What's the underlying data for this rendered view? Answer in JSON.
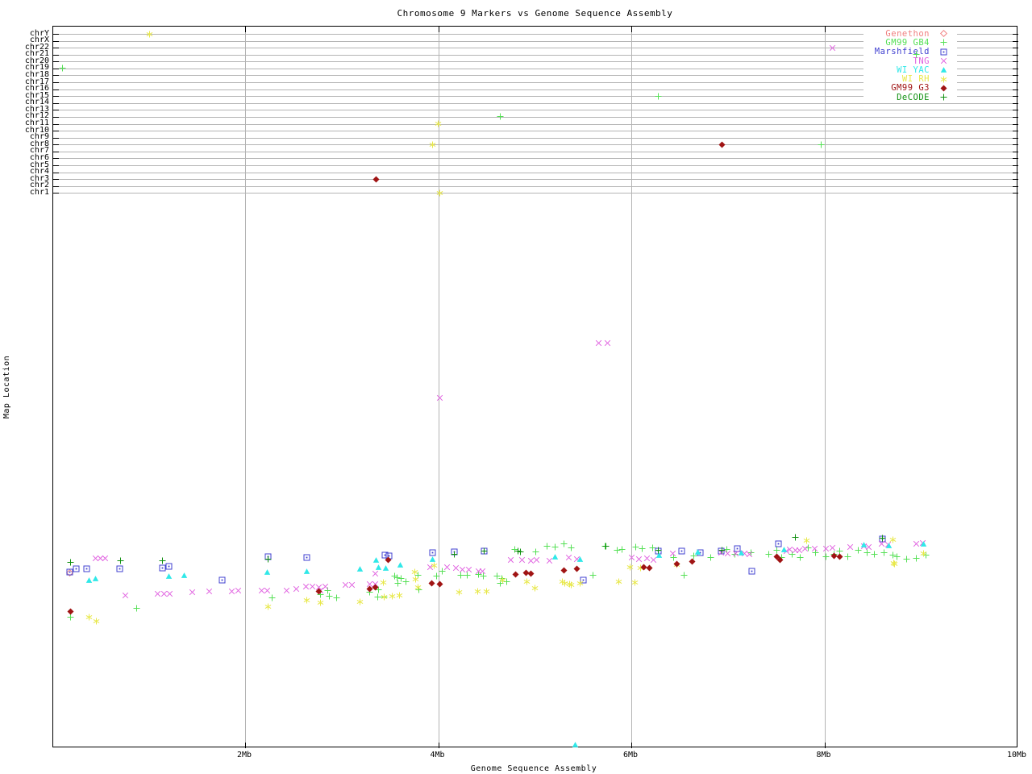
{
  "title": "Chromosome 9 Markers vs Genome Sequence Assembly",
  "axes": {
    "x_label": "Genome Sequence Assembly",
    "y_label": "Map Location",
    "x_ticks": [
      {
        "label": "2Mb",
        "mb": 2
      },
      {
        "label": "4Mb",
        "mb": 4
      },
      {
        "label": "6Mb",
        "mb": 6
      },
      {
        "label": "8Mb",
        "mb": 8
      },
      {
        "label": "10Mb",
        "mb": 10
      }
    ],
    "y_categories": [
      "chrY",
      "chrX",
      "chr22",
      "chr21",
      "chr20",
      "chr19",
      "chr18",
      "chr17",
      "chr16",
      "chr15",
      "chr14",
      "chr13",
      "chr12",
      "chr11",
      "chr10",
      "chr9",
      "chr8",
      "chr7",
      "chr6",
      "chr5",
      "chr4",
      "chr3",
      "chr2",
      "chr1"
    ]
  },
  "style": {
    "gridline_color": "#b4b4b4",
    "frame_color": "#000000",
    "background": "#ffffff"
  },
  "chart_data": {
    "type": "scatter",
    "title": "Chromosome 9 Markers vs Genome Sequence Assembly",
    "xlabel": "Genome Sequence Assembly",
    "ylabel": "Map Location",
    "x_unit": "Mb",
    "xlim": [
      0,
      10
    ],
    "x_gridlines_mb": [
      2,
      4,
      6,
      8
    ],
    "grid": true,
    "legend_position": "top-right",
    "y_axis_categories_top": [
      "chrY",
      "chrX",
      "chr22",
      "chr21",
      "chr20",
      "chr19",
      "chr18",
      "chr17",
      "chr16",
      "chr15",
      "chr14",
      "chr13",
      "chr12",
      "chr11",
      "chr10",
      "chr9",
      "chr8",
      "chr7",
      "chr6",
      "chr5",
      "chr4",
      "chr3",
      "chr2",
      "chr1"
    ],
    "point_format": [
      "x_mb",
      "y_screen_px"
    ],
    "series": [
      {
        "name": "Genethon",
        "color": "#f08080",
        "marker": "diamond-open",
        "chrom_hits": [],
        "band_points": [
          [
            0.18,
            709
          ]
        ]
      },
      {
        "name": "GM99 GB4",
        "color": "#55e055",
        "marker": "plus",
        "chrom_hits": [
          {
            "chrom": "chr19",
            "x_mb": 0.11
          },
          {
            "chrom": "chr21",
            "x_mb": 8.95
          },
          {
            "chrom": "chr15",
            "x_mb": 6.28
          },
          {
            "chrom": "chr12",
            "x_mb": 4.64
          },
          {
            "chrom": "chr8",
            "x_mb": 7.97
          }
        ],
        "band_points": [
          [
            0.19,
            764
          ],
          [
            0.88,
            753
          ],
          [
            2.28,
            740
          ],
          [
            2.78,
            736
          ],
          [
            2.86,
            731
          ],
          [
            2.87,
            738
          ],
          [
            2.95,
            740
          ],
          [
            3.29,
            733
          ],
          [
            3.38,
            730
          ],
          [
            3.37,
            739
          ],
          [
            3.44,
            739
          ],
          [
            3.55,
            713
          ],
          [
            3.57,
            715
          ],
          [
            3.62,
            716
          ],
          [
            3.67,
            720
          ],
          [
            3.58,
            722
          ],
          [
            3.79,
            712
          ],
          [
            3.8,
            730
          ],
          [
            3.98,
            713
          ],
          [
            4.04,
            707
          ],
          [
            4.23,
            712
          ],
          [
            4.3,
            712
          ],
          [
            4.42,
            711
          ],
          [
            4.47,
            713
          ],
          [
            4.61,
            713
          ],
          [
            4.66,
            716
          ],
          [
            4.71,
            720
          ],
          [
            4.64,
            722
          ],
          [
            4.79,
            680
          ],
          [
            5.01,
            683
          ],
          [
            5.13,
            676
          ],
          [
            5.21,
            677
          ],
          [
            5.3,
            673
          ],
          [
            5.38,
            678
          ],
          [
            5.6,
            712
          ],
          [
            5.73,
            676
          ],
          [
            5.85,
            681
          ],
          [
            5.9,
            680
          ],
          [
            6.05,
            677
          ],
          [
            6.11,
            679
          ],
          [
            6.22,
            678
          ],
          [
            6.44,
            690
          ],
          [
            6.55,
            712
          ],
          [
            6.65,
            688
          ],
          [
            6.82,
            690
          ],
          [
            6.99,
            680
          ],
          [
            7.07,
            686
          ],
          [
            7.24,
            684
          ],
          [
            7.42,
            686
          ],
          [
            7.51,
            681
          ],
          [
            7.56,
            690
          ],
          [
            7.67,
            686
          ],
          [
            7.75,
            690
          ],
          [
            7.83,
            678
          ],
          [
            7.91,
            684
          ],
          [
            8.02,
            689
          ],
          [
            8.1,
            686
          ],
          [
            8.16,
            682
          ],
          [
            8.24,
            689
          ],
          [
            8.35,
            681
          ],
          [
            8.44,
            684
          ],
          [
            8.52,
            686
          ],
          [
            8.62,
            684
          ],
          [
            8.71,
            687
          ],
          [
            8.75,
            689
          ],
          [
            8.85,
            692
          ],
          [
            8.95,
            691
          ],
          [
            9.05,
            687
          ]
        ]
      },
      {
        "name": "Marshfield",
        "color": "#4040d0",
        "marker": "box-dot",
        "chrom_hits": [],
        "band_points": [
          [
            0.25,
            704
          ],
          [
            0.36,
            704
          ],
          [
            0.18,
            708
          ],
          [
            0.7,
            704
          ],
          [
            1.14,
            703
          ],
          [
            1.21,
            701
          ],
          [
            1.76,
            718
          ],
          [
            2.24,
            689
          ],
          [
            2.64,
            690
          ],
          [
            3.45,
            687
          ],
          [
            3.49,
            688
          ],
          [
            3.94,
            684
          ],
          [
            4.17,
            683
          ],
          [
            4.48,
            682
          ],
          [
            5.5,
            718
          ],
          [
            6.28,
            682
          ],
          [
            6.52,
            682
          ],
          [
            6.71,
            684
          ],
          [
            6.93,
            682
          ],
          [
            7.1,
            679
          ],
          [
            7.25,
            707
          ],
          [
            7.52,
            673
          ],
          [
            8.6,
            667
          ]
        ]
      },
      {
        "name": "TNG",
        "color": "#e060e0",
        "marker": "cross",
        "chrom_hits": [
          {
            "chrom": "chr22",
            "x_mb": 8.08
          }
        ],
        "band_points": [
          [
            0.45,
            691
          ],
          [
            0.5,
            691
          ],
          [
            0.55,
            691
          ],
          [
            0.76,
            737
          ],
          [
            1.09,
            735
          ],
          [
            1.16,
            735
          ],
          [
            1.22,
            735
          ],
          [
            1.45,
            733
          ],
          [
            1.63,
            732
          ],
          [
            1.86,
            732
          ],
          [
            1.93,
            731
          ],
          [
            2.17,
            731
          ],
          [
            2.23,
            731
          ],
          [
            2.43,
            731
          ],
          [
            2.53,
            729
          ],
          [
            2.63,
            726
          ],
          [
            2.7,
            726
          ],
          [
            2.76,
            727
          ],
          [
            2.78,
            731
          ],
          [
            2.83,
            726
          ],
          [
            3.04,
            724
          ],
          [
            3.11,
            724
          ],
          [
            3.29,
            723
          ],
          [
            3.35,
            723
          ],
          [
            3.35,
            710
          ],
          [
            3.92,
            702
          ],
          [
            4.09,
            702
          ],
          [
            4.18,
            703
          ],
          [
            4.25,
            705
          ],
          [
            4.32,
            705
          ],
          [
            4.42,
            707
          ],
          [
            4.46,
            707
          ],
          [
            4.75,
            693
          ],
          [
            4.87,
            693
          ],
          [
            4.96,
            694
          ],
          [
            5.02,
            693
          ],
          [
            5.15,
            694
          ],
          [
            5.35,
            690
          ],
          [
            5.44,
            692
          ],
          [
            6.0,
            690
          ],
          [
            6.08,
            692
          ],
          [
            6.16,
            691
          ],
          [
            6.23,
            693
          ],
          [
            6.43,
            685
          ],
          [
            6.93,
            684
          ],
          [
            7.0,
            685
          ],
          [
            7.08,
            685
          ],
          [
            7.17,
            685
          ],
          [
            7.22,
            686
          ],
          [
            7.61,
            682
          ],
          [
            7.64,
            680
          ],
          [
            7.7,
            681
          ],
          [
            7.74,
            681
          ],
          [
            7.8,
            679
          ],
          [
            7.9,
            679
          ],
          [
            8.02,
            679
          ],
          [
            8.08,
            678
          ],
          [
            8.27,
            677
          ],
          [
            8.41,
            676
          ],
          [
            8.46,
            677
          ],
          [
            8.59,
            673
          ],
          [
            8.66,
            674
          ],
          [
            8.95,
            673
          ],
          [
            9.02,
            672
          ],
          [
            5.66,
            424
          ],
          [
            5.75,
            424
          ],
          [
            4.02,
            492
          ]
        ]
      },
      {
        "name": "WI YAC",
        "color": "#30e8e8",
        "marker": "triangle-filled",
        "chrom_hits": [],
        "band_points": [
          [
            0.38,
            718
          ],
          [
            0.45,
            716
          ],
          [
            1.21,
            713
          ],
          [
            1.37,
            712
          ],
          [
            2.23,
            708
          ],
          [
            2.64,
            707
          ],
          [
            3.19,
            704
          ],
          [
            3.36,
            693
          ],
          [
            3.38,
            702
          ],
          [
            3.46,
            703
          ],
          [
            3.61,
            699
          ],
          [
            3.94,
            692
          ],
          [
            5.21,
            689
          ],
          [
            5.47,
            692
          ],
          [
            6.29,
            687
          ],
          [
            6.69,
            683
          ],
          [
            7.14,
            684
          ],
          [
            7.58,
            680
          ],
          [
            8.41,
            674
          ],
          [
            8.67,
            675
          ],
          [
            9.03,
            673
          ],
          [
            5.42,
            922
          ]
        ]
      },
      {
        "name": "WI RH",
        "color": "#e8e84a",
        "marker": "asterisk",
        "chrom_hits": [
          {
            "chrom": "chrY",
            "x_mb": 1.01
          },
          {
            "chrom": "chr11",
            "x_mb": 4.0
          },
          {
            "chrom": "chr8",
            "x_mb": 3.94
          },
          {
            "chrom": "chr1",
            "x_mb": 4.02
          }
        ],
        "band_points": [
          [
            0.38,
            764
          ],
          [
            0.46,
            769
          ],
          [
            2.24,
            751
          ],
          [
            2.64,
            743
          ],
          [
            2.78,
            746
          ],
          [
            3.19,
            745
          ],
          [
            3.43,
            721
          ],
          [
            3.52,
            738
          ],
          [
            3.44,
            739
          ],
          [
            3.6,
            737
          ],
          [
            3.76,
            708
          ],
          [
            3.77,
            717
          ],
          [
            3.79,
            727
          ],
          [
            3.96,
            700
          ],
          [
            4.22,
            733
          ],
          [
            4.41,
            732
          ],
          [
            4.5,
            732
          ],
          [
            4.67,
            718
          ],
          [
            4.92,
            720
          ],
          [
            5.0,
            728
          ],
          [
            5.29,
            720
          ],
          [
            5.31,
            722
          ],
          [
            5.36,
            723
          ],
          [
            5.38,
            724
          ],
          [
            5.47,
            722
          ],
          [
            5.87,
            720
          ],
          [
            5.99,
            702
          ],
          [
            6.04,
            721
          ],
          [
            6.1,
            703
          ],
          [
            6.47,
            699
          ],
          [
            7.82,
            669
          ],
          [
            8.71,
            668
          ],
          [
            8.72,
            697
          ],
          [
            8.73,
            698
          ],
          [
            9.03,
            685
          ]
        ]
      },
      {
        "name": "GM99 G3",
        "color": "#a01414",
        "marker": "diamond-filled",
        "chrom_hits": [
          {
            "chrom": "chr8",
            "x_mb": 6.94
          },
          {
            "chrom": "chr3",
            "x_mb": 3.36
          }
        ],
        "band_points": [
          [
            0.19,
            757
          ],
          [
            2.76,
            732
          ],
          [
            3.29,
            729
          ],
          [
            3.35,
            727
          ],
          [
            3.48,
            693
          ],
          [
            3.93,
            722
          ],
          [
            4.02,
            723
          ],
          [
            4.8,
            711
          ],
          [
            4.91,
            709
          ],
          [
            4.96,
            710
          ],
          [
            5.3,
            706
          ],
          [
            5.44,
            704
          ],
          [
            6.13,
            702
          ],
          [
            6.19,
            703
          ],
          [
            6.47,
            698
          ],
          [
            6.63,
            695
          ],
          [
            7.51,
            689
          ],
          [
            7.54,
            693
          ],
          [
            8.1,
            688
          ],
          [
            8.16,
            689
          ]
        ]
      },
      {
        "name": "DeCODE",
        "color": "#109010",
        "marker": "plus",
        "chrom_hits": [],
        "band_points": [
          [
            0.19,
            696
          ],
          [
            0.71,
            694
          ],
          [
            1.14,
            694
          ],
          [
            2.24,
            692
          ],
          [
            4.17,
            686
          ],
          [
            4.48,
            682
          ],
          [
            4.83,
            682
          ],
          [
            4.85,
            683
          ],
          [
            5.74,
            676
          ],
          [
            6.28,
            681
          ],
          [
            6.94,
            681
          ],
          [
            7.7,
            665
          ],
          [
            8.6,
            666
          ]
        ]
      }
    ]
  }
}
